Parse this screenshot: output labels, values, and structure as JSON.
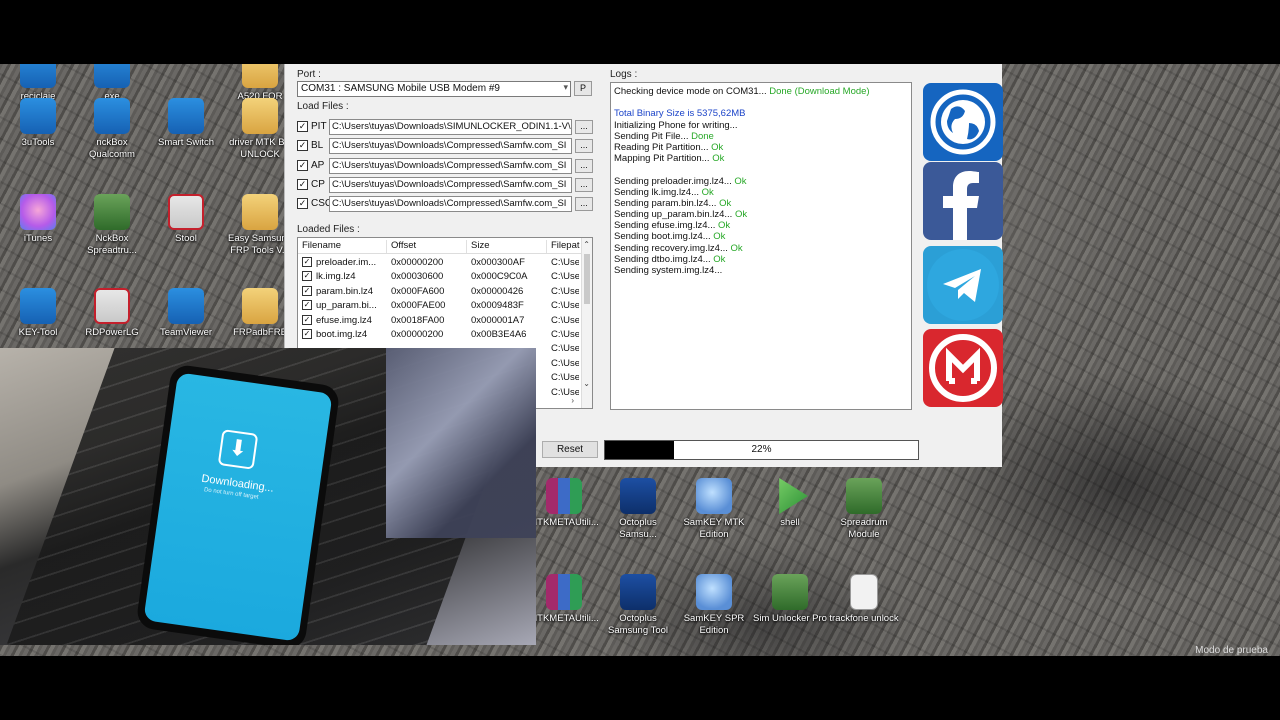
{
  "desktop": {
    "icons": [
      {
        "label": "reciclaje",
        "icon": "recycle-bin-icon"
      },
      {
        "label": "exe",
        "icon": "exe-icon"
      },
      {
        "label": "A520 FOR",
        "icon": "folder-icon"
      },
      {
        "label": "3uTools",
        "icon": "3utools-icon"
      },
      {
        "label": "nckBox Qualcomm",
        "icon": "nckbox-icon"
      },
      {
        "label": "Smart Switch",
        "icon": "smart-switch-icon"
      },
      {
        "label": "driver MTK BY UNLOCK",
        "icon": "folder-icon"
      },
      {
        "label": "iTunes",
        "icon": "itunes-icon"
      },
      {
        "label": "NckBox Spreadtru...",
        "icon": "nckbox-spreadtrum-icon"
      },
      {
        "label": "Stool",
        "icon": "stool-icon"
      },
      {
        "label": "Easy Samsung FRP Tools V...",
        "icon": "folder-icon"
      },
      {
        "label": "KEY-Tool",
        "icon": "key-tool-icon"
      },
      {
        "label": "RDPowerLG",
        "icon": "lg-icon"
      },
      {
        "label": "TeamViewer",
        "icon": "teamviewer-icon"
      },
      {
        "label": "FRPadbFRE",
        "icon": "folder-icon"
      },
      {
        "label": "MTKMETAUtili...",
        "icon": "winrar-icon"
      },
      {
        "label": "Octoplus Samsu...",
        "icon": "octoplus-icon"
      },
      {
        "label": "SamKEY MTK Edition",
        "icon": "samkey-icon"
      },
      {
        "label": "shell",
        "icon": "shell-icon"
      },
      {
        "label": "Spreadrum Module",
        "icon": "spreadrum-icon"
      },
      {
        "label": "MTKMETAUtili...",
        "icon": "winrar-icon"
      },
      {
        "label": "Octoplus Samsung Tool",
        "icon": "octoplus-classic-icon"
      },
      {
        "label": "SamKEY SPR Edition",
        "icon": "samkey-icon"
      },
      {
        "label": "Sim Unlocker Pro",
        "icon": "sim-unlocker-icon"
      },
      {
        "label": "trackfone unlock",
        "icon": "text-file-icon"
      }
    ],
    "watermark": "Modo de prueba"
  },
  "app": {
    "port_label": "Port :",
    "port_value": "COM31 : SAMSUNG Mobile USB Modem #9",
    "port_button": "P",
    "load_files_label": "Load Files :",
    "files": [
      {
        "type": "PIT",
        "path": "C:\\Users\\tuyas\\Downloads\\SIMUNLOCKER_ODIN1.1-V\\"
      },
      {
        "type": "BL",
        "path": "C:\\Users\\tuyas\\Downloads\\Compressed\\Samfw.com_SI"
      },
      {
        "type": "AP",
        "path": "C:\\Users\\tuyas\\Downloads\\Compressed\\Samfw.com_SI"
      },
      {
        "type": "CP",
        "path": "C:\\Users\\tuyas\\Downloads\\Compressed\\Samfw.com_SI"
      },
      {
        "type": "CSC",
        "path": "C:\\Users\\tuyas\\Downloads\\Compressed\\Samfw.com_SI"
      }
    ],
    "browse_label": "...",
    "loaded_files_label": "Loaded Files :",
    "table_headers": [
      "Filename",
      "Offset",
      "Size",
      "Filepat"
    ],
    "table_rows": [
      {
        "name": "preloader.im...",
        "offset": "0x00000200",
        "size": "0x000300AF",
        "path": "C:\\Use"
      },
      {
        "name": "lk.img.lz4",
        "offset": "0x00030600",
        "size": "0x000C9C0A",
        "path": "C:\\Use"
      },
      {
        "name": "param.bin.lz4",
        "offset": "0x000FA600",
        "size": "0x00000426",
        "path": "C:\\Use"
      },
      {
        "name": "up_param.bi...",
        "offset": "0x000FAE00",
        "size": "0x0009483F",
        "path": "C:\\Use"
      },
      {
        "name": "efuse.img.lz4",
        "offset": "0x0018FA00",
        "size": "0x000001A7",
        "path": "C:\\Use"
      },
      {
        "name": "boot.img.lz4",
        "offset": "0x00000200",
        "size": "0x00B3E4A6",
        "path": "C:\\Use"
      },
      {
        "name": "",
        "offset": "",
        "size": "",
        "path": "C:\\Use"
      },
      {
        "name": "",
        "offset": "",
        "size": "",
        "path": "C:\\Use"
      },
      {
        "name": "",
        "offset": "",
        "size": "",
        "path": "C:\\Use"
      },
      {
        "name": "",
        "offset": "",
        "size": "",
        "path": "C:\\Use"
      }
    ],
    "logs_label": "Logs :",
    "logs": [
      {
        "text": "Checking device mode on COM31...",
        "status": "Done (Download Mode)",
        "cls": "ok"
      },
      {
        "text": "",
        "status": "",
        "cls": ""
      },
      {
        "text": "Total Binary Size is 5375,62MB",
        "status": "",
        "cls": "info"
      },
      {
        "text": "Initializing Phone for writing...",
        "status": "",
        "cls": ""
      },
      {
        "text": "Sending Pit File...",
        "status": "Done",
        "cls": "ok"
      },
      {
        "text": "Reading Pit Partition...",
        "status": "Ok",
        "cls": "ok"
      },
      {
        "text": "Mapping Pit Partition...",
        "status": "Ok",
        "cls": "ok"
      },
      {
        "text": "",
        "status": "",
        "cls": ""
      },
      {
        "text": "Sending preloader.img.lz4...",
        "status": "Ok",
        "cls": "ok"
      },
      {
        "text": "Sending lk.img.lz4...",
        "status": "Ok",
        "cls": "ok"
      },
      {
        "text": "Sending param.bin.lz4...",
        "status": "Ok",
        "cls": "ok"
      },
      {
        "text": "Sending up_param.bin.lz4...",
        "status": "Ok",
        "cls": "ok"
      },
      {
        "text": "Sending efuse.img.lz4...",
        "status": "Ok",
        "cls": "ok"
      },
      {
        "text": "Sending boot.img.lz4...",
        "status": "Ok",
        "cls": "ok"
      },
      {
        "text": "Sending recovery.img.lz4...",
        "status": "Ok",
        "cls": "ok"
      },
      {
        "text": "Sending dtbo.img.lz4...",
        "status": "Ok",
        "cls": "ok"
      },
      {
        "text": "Sending system.img.lz4...",
        "status": "",
        "cls": ""
      }
    ],
    "reset_label": "Reset",
    "progress_text": "22%",
    "progress_value": 0.22,
    "social": [
      "globe-icon",
      "facebook-icon",
      "telegram-icon",
      "mega-icon"
    ]
  },
  "camera": {
    "phone_text": "Downloading...",
    "phone_subtext": "Do not turn off target"
  },
  "colors": {
    "ok": "#27a827",
    "info": "#1d45c9",
    "progress_fill": "#000000"
  }
}
